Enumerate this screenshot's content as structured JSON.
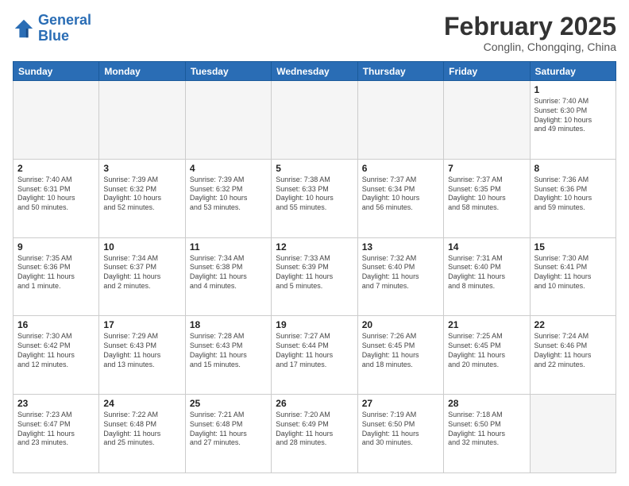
{
  "header": {
    "logo_line1": "General",
    "logo_line2": "Blue",
    "month_title": "February 2025",
    "subtitle": "Conglin, Chongqing, China"
  },
  "days_of_week": [
    "Sunday",
    "Monday",
    "Tuesday",
    "Wednesday",
    "Thursday",
    "Friday",
    "Saturday"
  ],
  "weeks": [
    [
      {
        "day": "",
        "info": ""
      },
      {
        "day": "",
        "info": ""
      },
      {
        "day": "",
        "info": ""
      },
      {
        "day": "",
        "info": ""
      },
      {
        "day": "",
        "info": ""
      },
      {
        "day": "",
        "info": ""
      },
      {
        "day": "1",
        "info": "Sunrise: 7:40 AM\nSunset: 6:30 PM\nDaylight: 10 hours\nand 49 minutes."
      }
    ],
    [
      {
        "day": "2",
        "info": "Sunrise: 7:40 AM\nSunset: 6:31 PM\nDaylight: 10 hours\nand 50 minutes."
      },
      {
        "day": "3",
        "info": "Sunrise: 7:39 AM\nSunset: 6:32 PM\nDaylight: 10 hours\nand 52 minutes."
      },
      {
        "day": "4",
        "info": "Sunrise: 7:39 AM\nSunset: 6:32 PM\nDaylight: 10 hours\nand 53 minutes."
      },
      {
        "day": "5",
        "info": "Sunrise: 7:38 AM\nSunset: 6:33 PM\nDaylight: 10 hours\nand 55 minutes."
      },
      {
        "day": "6",
        "info": "Sunrise: 7:37 AM\nSunset: 6:34 PM\nDaylight: 10 hours\nand 56 minutes."
      },
      {
        "day": "7",
        "info": "Sunrise: 7:37 AM\nSunset: 6:35 PM\nDaylight: 10 hours\nand 58 minutes."
      },
      {
        "day": "8",
        "info": "Sunrise: 7:36 AM\nSunset: 6:36 PM\nDaylight: 10 hours\nand 59 minutes."
      }
    ],
    [
      {
        "day": "9",
        "info": "Sunrise: 7:35 AM\nSunset: 6:36 PM\nDaylight: 11 hours\nand 1 minute."
      },
      {
        "day": "10",
        "info": "Sunrise: 7:34 AM\nSunset: 6:37 PM\nDaylight: 11 hours\nand 2 minutes."
      },
      {
        "day": "11",
        "info": "Sunrise: 7:34 AM\nSunset: 6:38 PM\nDaylight: 11 hours\nand 4 minutes."
      },
      {
        "day": "12",
        "info": "Sunrise: 7:33 AM\nSunset: 6:39 PM\nDaylight: 11 hours\nand 5 minutes."
      },
      {
        "day": "13",
        "info": "Sunrise: 7:32 AM\nSunset: 6:40 PM\nDaylight: 11 hours\nand 7 minutes."
      },
      {
        "day": "14",
        "info": "Sunrise: 7:31 AM\nSunset: 6:40 PM\nDaylight: 11 hours\nand 8 minutes."
      },
      {
        "day": "15",
        "info": "Sunrise: 7:30 AM\nSunset: 6:41 PM\nDaylight: 11 hours\nand 10 minutes."
      }
    ],
    [
      {
        "day": "16",
        "info": "Sunrise: 7:30 AM\nSunset: 6:42 PM\nDaylight: 11 hours\nand 12 minutes."
      },
      {
        "day": "17",
        "info": "Sunrise: 7:29 AM\nSunset: 6:43 PM\nDaylight: 11 hours\nand 13 minutes."
      },
      {
        "day": "18",
        "info": "Sunrise: 7:28 AM\nSunset: 6:43 PM\nDaylight: 11 hours\nand 15 minutes."
      },
      {
        "day": "19",
        "info": "Sunrise: 7:27 AM\nSunset: 6:44 PM\nDaylight: 11 hours\nand 17 minutes."
      },
      {
        "day": "20",
        "info": "Sunrise: 7:26 AM\nSunset: 6:45 PM\nDaylight: 11 hours\nand 18 minutes."
      },
      {
        "day": "21",
        "info": "Sunrise: 7:25 AM\nSunset: 6:45 PM\nDaylight: 11 hours\nand 20 minutes."
      },
      {
        "day": "22",
        "info": "Sunrise: 7:24 AM\nSunset: 6:46 PM\nDaylight: 11 hours\nand 22 minutes."
      }
    ],
    [
      {
        "day": "23",
        "info": "Sunrise: 7:23 AM\nSunset: 6:47 PM\nDaylight: 11 hours\nand 23 minutes."
      },
      {
        "day": "24",
        "info": "Sunrise: 7:22 AM\nSunset: 6:48 PM\nDaylight: 11 hours\nand 25 minutes."
      },
      {
        "day": "25",
        "info": "Sunrise: 7:21 AM\nSunset: 6:48 PM\nDaylight: 11 hours\nand 27 minutes."
      },
      {
        "day": "26",
        "info": "Sunrise: 7:20 AM\nSunset: 6:49 PM\nDaylight: 11 hours\nand 28 minutes."
      },
      {
        "day": "27",
        "info": "Sunrise: 7:19 AM\nSunset: 6:50 PM\nDaylight: 11 hours\nand 30 minutes."
      },
      {
        "day": "28",
        "info": "Sunrise: 7:18 AM\nSunset: 6:50 PM\nDaylight: 11 hours\nand 32 minutes."
      },
      {
        "day": "",
        "info": ""
      }
    ]
  ]
}
